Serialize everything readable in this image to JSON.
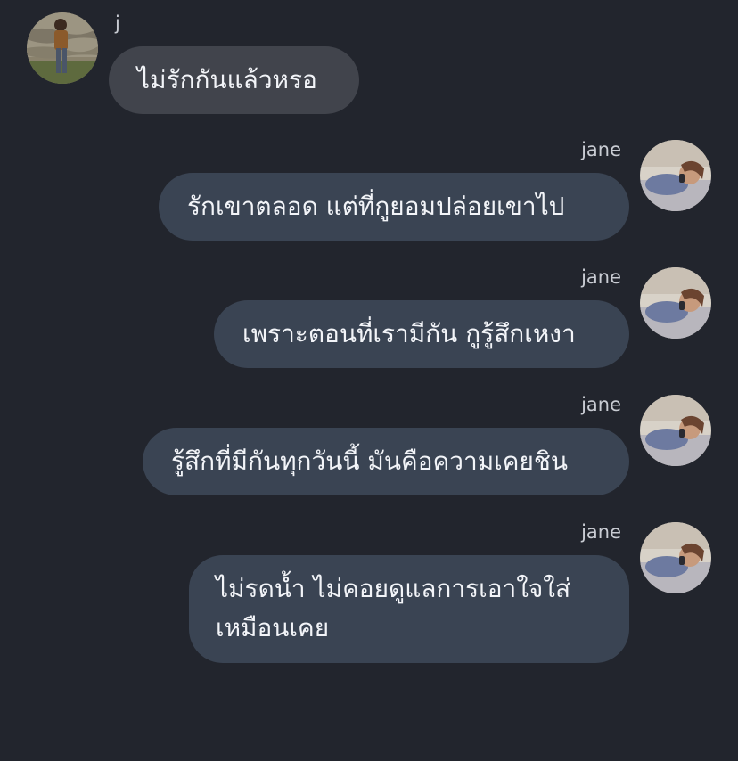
{
  "chat": {
    "incoming": {
      "sender": "j",
      "avatar": "person-standing-avatar",
      "message": "ไม่รักกันแล้วหรอ"
    },
    "outgoing": [
      {
        "sender": "jane",
        "avatar": "person-lying-avatar",
        "message": "รักเขาตลอด แต่ที่กูยอมปล่อยเขาไป"
      },
      {
        "sender": "jane",
        "avatar": "person-lying-avatar",
        "message": "เพราะตอนที่เรามีกัน กูรู้สึกเหงา"
      },
      {
        "sender": "jane",
        "avatar": "person-lying-avatar",
        "message": "รู้สึกที่มีกันทุกวันนี้ มันคือความเคยชิน"
      },
      {
        "sender": "jane",
        "avatar": "person-lying-avatar",
        "message": "ไม่รดน้ำ ไม่คอยดูแลการเอาใจใส่ เหมือนเคย"
      }
    ]
  },
  "colors": {
    "background": "#22252d",
    "incoming_bubble": "#41444c",
    "outgoing_bubble": "#3a4453",
    "text": "#f2f4f8",
    "sender_text": "#c9ccd3"
  }
}
